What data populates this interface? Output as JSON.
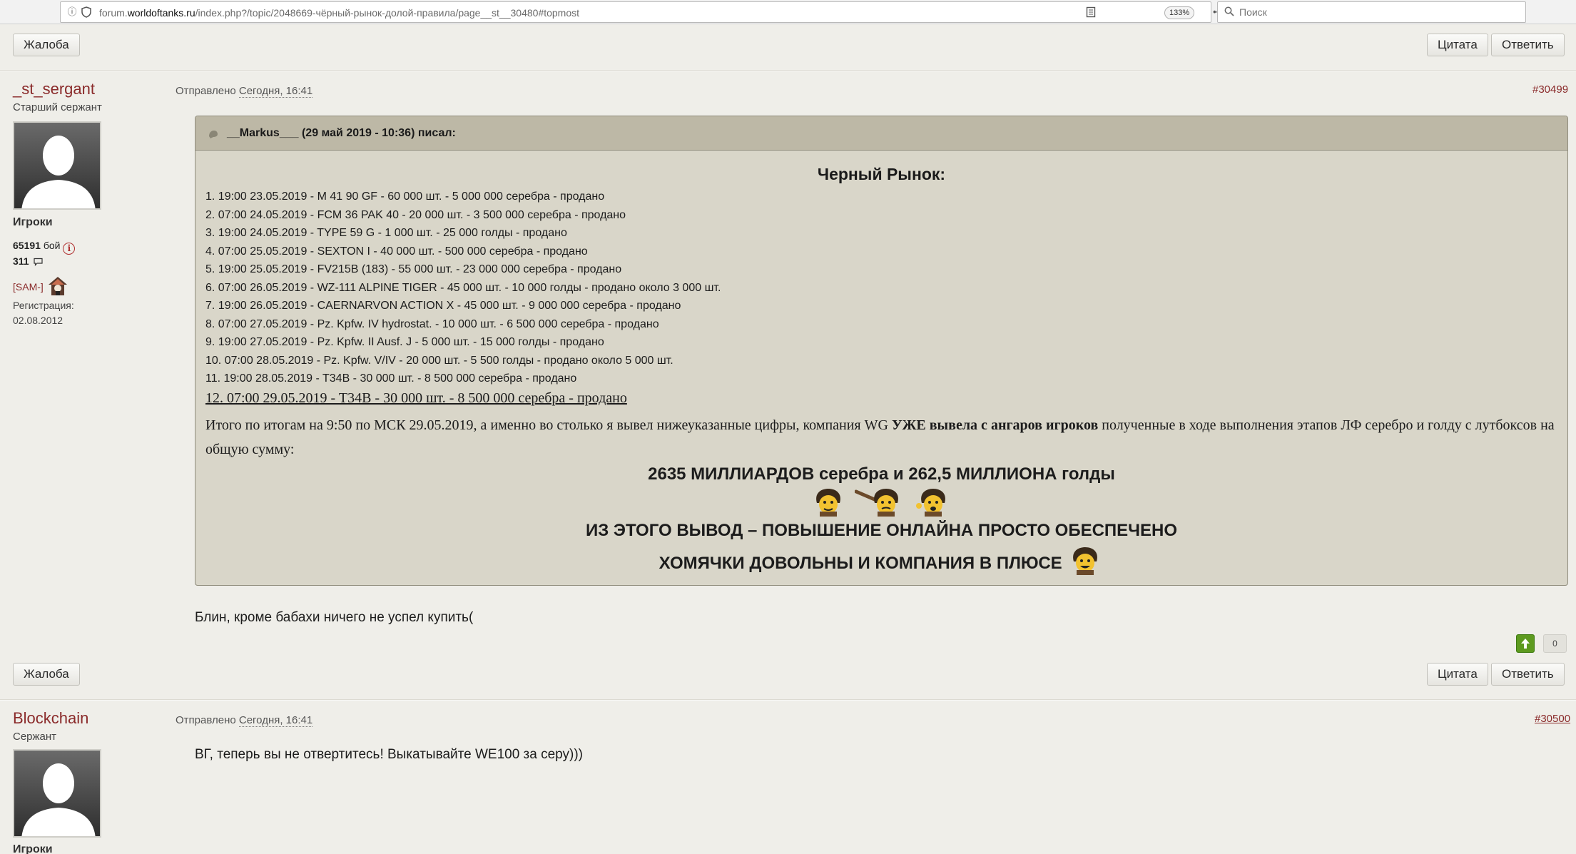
{
  "browser": {
    "url_prefix": "forum.",
    "url_domain": "worldoftanks.ru",
    "url_path": "/index.php?/topic/2048669-чёрный-рынок-долой-правила/page__st__30480#topmost",
    "zoom": "133%",
    "search_placeholder": "Поиск"
  },
  "buttons": {
    "report": "Жалоба",
    "quote": "Цитата",
    "reply": "Ответить"
  },
  "posts": [
    {
      "author": "_st_sergant",
      "rank": "Старший сержант",
      "group": "Игроки",
      "battles_num": "65191",
      "battles_label": " бой",
      "posts_num": "311",
      "clan": "[SAM-]",
      "reg_label": "Регистрация:",
      "reg_date": "02.08.2012",
      "sent_label": "Отправлено ",
      "sent_time": "Сегодня, 16:41",
      "post_number": "#30499",
      "quote": {
        "cite": "__Markus___ (29 май 2019 - 10:36) писал:",
        "title": "Черный Рынок:",
        "items": [
          "1. 19:00 23.05.2019 - M 41 90 GF - 60 000 шт. - 5 000 000 серебра - продано",
          "2. 07:00 24.05.2019 - FCM 36 PAK 40 - 20 000 шт. - 3 500 000 серебра - продано",
          "3. 19:00 24.05.2019 - TYPE 59 G - 1 000 шт. - 25 000 голды - продано",
          "4. 07:00 25.05.2019 - SEXTON I - 40 000 шт. - 500 000 серебра - продано",
          "5. 19:00 25.05.2019 - FV215B (183) - 55 000 шт. - 23 000 000 серебра - продано",
          "6. 07:00 26.05.2019 - WZ-111 ALPINE TIGER - 45 000 шт. - 10 000 голды - продано около 3 000 шт.",
          "7. 19:00 26.05.2019 - CAERNARVON ACTION X - 45 000 шт. - 9 000 000 серебра - продано",
          "8. 07:00 27.05.2019 - Pz. Kpfw. IV hydrostat. - 10 000 шт. - 6 500 000 серебра - продано",
          "9. 19:00 27.05.2019 - Pz. Kpfw. II Ausf. J - 5 000 шт. - 15 000 голды - продано",
          "10. 07:00 28.05.2019 - Pz. Kpfw. V/IV - 20 000 шт. - 5 500 голды - продано около 5 000 шт.",
          "11. 19:00 28.05.2019 - T34B - 30 000 шт. - 8 500 000 серебра - продано"
        ],
        "item12": "12. 07:00 29.05.2019 - T34B - 30 000 шт. - 8 500 000 серебра - продано",
        "para_start": "Итого по итогам на 9:50 по МСК 29.05.2019, а именно во столько я вывел нижеуказанные цифры, компания WG ",
        "para_bold": "УЖЕ вывела с ангаров игроков",
        "para_end": " полученные в ходе выполнения этапов ЛФ серебро и голду с лутбоксов на общую сумму:",
        "total": "2635 МИЛЛИАРДОВ серебра и 262,5 МИЛЛИОНА голды",
        "conclusion1": "ИЗ ЭТОГО ВЫВОД – ПОВЫШЕНИЕ ОНЛАЙНА ПРОСТО ОБЕСПЕЧЕНО",
        "conclusion2": "ХОМЯЧКИ ДОВОЛЬНЫ И КОМПАНИЯ В ПЛЮСЕ"
      },
      "text": "Блин, кроме бабахи ничего не успел купить(",
      "votes": "0"
    },
    {
      "author": "Blockchain",
      "rank": "Сержант",
      "group": "Игроки",
      "sent_label": "Отправлено ",
      "sent_time": "Сегодня, 16:41",
      "post_number": "#30500",
      "text": "ВГ, теперь вы не отвертитесь! Выкатывайте WE100 за серу)))"
    }
  ],
  "colors": {
    "page_bg": "#efeee9",
    "author": "#8a2a2a",
    "quote_bg": "#d9d6c9",
    "quote_head": "#bdb8a6",
    "vote_up": "#5d9a1f"
  }
}
